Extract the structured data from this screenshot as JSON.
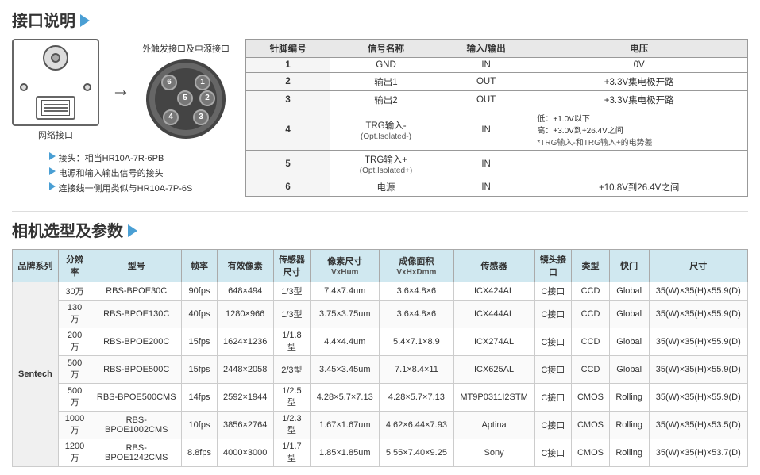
{
  "port_section": {
    "title": "接口说明",
    "connector_label": "外触发接口及电源接口",
    "network_label": "网络接口",
    "bullet_notes": [
      "接头：相当HR10A-7R-6PB",
      "电源和输入输出信号的接头",
      "连接线一侧用类似与HR10A-7P-6S"
    ],
    "pin_table": {
      "headers": [
        "针脚编号",
        "信号名称",
        "输入/输出",
        "电压"
      ],
      "rows": [
        {
          "pin": "1",
          "signal": "GND",
          "io": "IN",
          "voltage": "0V"
        },
        {
          "pin": "2",
          "signal": "输出1",
          "io": "OUT",
          "voltage": "+3.3V集电极开路"
        },
        {
          "pin": "3",
          "signal": "输出2",
          "io": "OUT",
          "voltage": "+3.3V集电极开路"
        },
        {
          "pin": "4",
          "signal": "TRG输入-\n(Opt.Isolated-)",
          "io": "IN",
          "voltage": "低：+1.0V以下\n高：+3.0V到+26.4V之间\n*TRG输入-和TRG输入+的电势差"
        },
        {
          "pin": "5",
          "signal": "TRG输入+\n(Opt.Isolated+)",
          "io": "IN",
          "voltage": ""
        },
        {
          "pin": "6",
          "signal": "电源",
          "io": "IN",
          "voltage": "+10.8V到26.4V之间"
        }
      ]
    }
  },
  "camera_section": {
    "title": "相机选型及参数",
    "table": {
      "headers": [
        {
          "label": "品牌系列",
          "sub": ""
        },
        {
          "label": "分辨率",
          "sub": ""
        },
        {
          "label": "型号",
          "sub": ""
        },
        {
          "label": "帧率",
          "sub": ""
        },
        {
          "label": "有效像素",
          "sub": ""
        },
        {
          "label": "传感器尺寸",
          "sub": ""
        },
        {
          "label": "像素尺寸",
          "sub": "VxHum"
        },
        {
          "label": "成像面积",
          "sub": "VxHxDmm"
        },
        {
          "label": "传感器",
          "sub": ""
        },
        {
          "label": "镜头接口",
          "sub": ""
        },
        {
          "label": "类型",
          "sub": ""
        },
        {
          "label": "快门",
          "sub": ""
        },
        {
          "label": "尺寸",
          "sub": ""
        }
      ],
      "brand": "Sentech",
      "rows": [
        {
          "res": "30万",
          "model": "RBS-BPOE30C",
          "fps": "90fps",
          "pixels": "648×494",
          "sensor_size": "1/3型",
          "pixel_size": "7.4×7.4um",
          "img_area": "3.6×4.8×6",
          "sensor": "ICX424AL",
          "interface": "C接口",
          "type": "CCD",
          "shutter": "Global",
          "dim": "35(W)×35(H)×55.9(D)"
        },
        {
          "res": "130万",
          "model": "RBS-BPOE130C",
          "fps": "40fps",
          "pixels": "1280×966",
          "sensor_size": "1/3型",
          "pixel_size": "3.75×3.75um",
          "img_area": "3.6×4.8×6",
          "sensor": "ICX444AL",
          "interface": "C接口",
          "type": "CCD",
          "shutter": "Global",
          "dim": "35(W)×35(H)×55.9(D)"
        },
        {
          "res": "200万",
          "model": "RBS-BPOE200C",
          "fps": "15fps",
          "pixels": "1624×1236",
          "sensor_size": "1/1.8型",
          "pixel_size": "4.4×4.4um",
          "img_area": "5.4×7.1×8.9",
          "sensor": "ICX274AL",
          "interface": "C接口",
          "type": "CCD",
          "shutter": "Global",
          "dim": "35(W)×35(H)×55.9(D)"
        },
        {
          "res": "500万",
          "model": "RBS-BPOE500C",
          "fps": "15fps",
          "pixels": "2448×2058",
          "sensor_size": "2/3型",
          "pixel_size": "3.45×3.45um",
          "img_area": "7.1×8.4×11",
          "sensor": "ICX625AL",
          "interface": "C接口",
          "type": "CCD",
          "shutter": "Global",
          "dim": "35(W)×35(H)×55.9(D)"
        },
        {
          "res": "500万",
          "model": "RBS-BPOE500CMS",
          "fps": "14fps",
          "pixels": "2592×1944",
          "sensor_size": "1/2.5型",
          "pixel_size": "4.28×5.7×7.13",
          "img_area": "4.28×5.7×7.13",
          "sensor": "MT9P0311I2STM",
          "interface": "C接口",
          "type": "CMOS",
          "shutter": "Rolling",
          "dim": "35(W)×35(H)×55.9(D)"
        },
        {
          "res": "1000万",
          "model": "RBS-BPOE1002CMS",
          "fps": "10fps",
          "pixels": "3856×2764",
          "sensor_size": "1/2.3型",
          "pixel_size": "1.67×1.67um",
          "img_area": "4.62×6.44×7.93",
          "sensor": "Aptina",
          "interface": "C接口",
          "type": "CMOS",
          "shutter": "Rolling",
          "dim": "35(W)×35(H)×53.5(D)"
        },
        {
          "res": "1200万",
          "model": "RBS-BPOE1242CMS",
          "fps": "8.8fps",
          "pixels": "4000×3000",
          "sensor_size": "1/1.7型",
          "pixel_size": "1.85×1.85um",
          "img_area": "5.55×7.40×9.25",
          "sensor": "Sony",
          "interface": "C接口",
          "type": "CMOS",
          "shutter": "Rolling",
          "dim": "35(W)×35(H)×53.7(D)"
        }
      ]
    }
  }
}
